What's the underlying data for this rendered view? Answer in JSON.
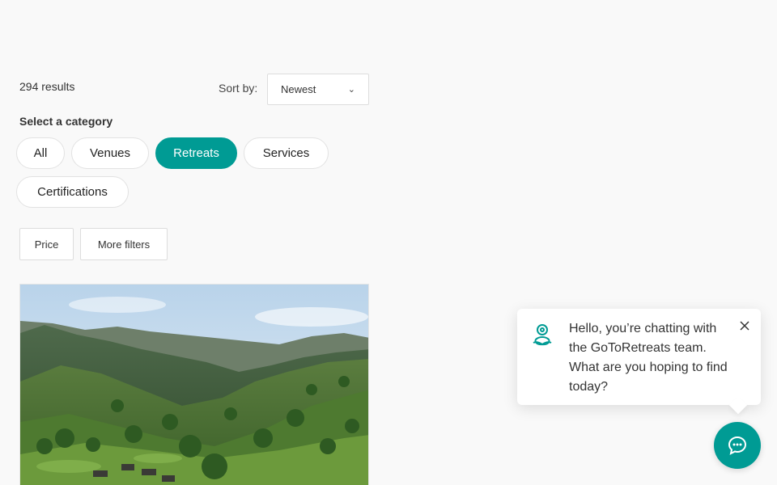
{
  "results": {
    "count_text": "294 results"
  },
  "sort": {
    "label": "Sort by:",
    "selected": "Newest"
  },
  "categories": {
    "label": "Select a category",
    "items": [
      "All",
      "Venues",
      "Retreats",
      "Services",
      "Certifications"
    ],
    "active": "Retreats"
  },
  "filters": {
    "price": "Price",
    "more": "More filters"
  },
  "listing": {
    "image_icon": "landscape-photo"
  },
  "chat": {
    "message": "Hello, you’re chatting with the GoToRetreats team. What are you hoping to find today?",
    "logo_icon": "yoga-person-icon",
    "close_icon": "close-icon",
    "launcher_icon": "chat-icon"
  },
  "colors": {
    "accent": "#009b94",
    "background": "#f9f9f9"
  }
}
